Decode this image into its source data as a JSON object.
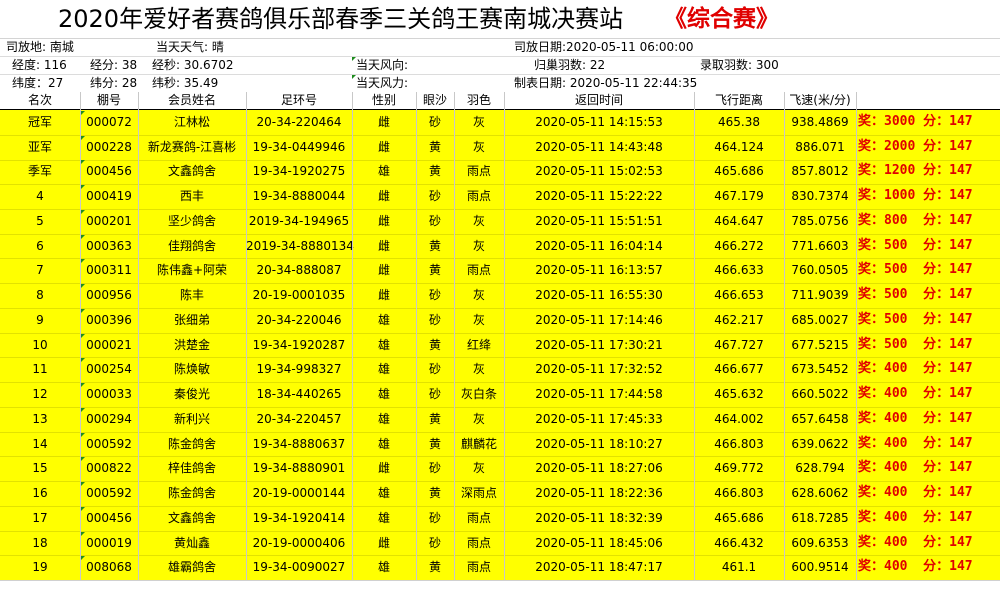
{
  "title": {
    "main": "2020年爱好者赛鸽俱乐部春季三关鸽王赛南城决赛站",
    "tag": "《综合赛》"
  },
  "info": {
    "release_place": "司放地: 南城",
    "weather": "当天天气: 晴",
    "release_date": "司放日期:2020-05-11 06:00:00",
    "longitude_deg": "经度: 116",
    "longitude_min": "经分: 38",
    "longitude_sec": "经秒: 30.6702",
    "wind_dir": "当天风向:",
    "returned": "归巢羽数: 22",
    "recorded": "录取羽数: 300",
    "latitude_deg": "纬度：27",
    "latitude_min": "纬分: 28",
    "latitude_sec": "纬秒: 35.49",
    "wind_force": "当天风力:",
    "made_date": "制表日期: 2020-05-11 22:44:35"
  },
  "columns": [
    "名次",
    "棚号",
    "会员姓名",
    "足环号",
    "性别",
    "眼沙",
    "羽色",
    "返回时间",
    "飞行距离",
    "飞速(米/分)"
  ],
  "rows": [
    {
      "rank": "冠军",
      "loft": "000072",
      "name": "江林松",
      "ring": "20-34-220464",
      "sex": "雌",
      "eye": "砂",
      "color": "灰",
      "time": "2020-05-11 14:15:53",
      "dist": "465.38",
      "speed": "938.4869",
      "prize": "奖：3000 分：147"
    },
    {
      "rank": "亚军",
      "loft": "000228",
      "name": "新龙赛鸽-江喜彬",
      "ring": "19-34-0449946",
      "sex": "雌",
      "eye": "黄",
      "color": "灰",
      "time": "2020-05-11 14:43:48",
      "dist": "464.124",
      "speed": "886.071",
      "prize": "奖：2000 分：147"
    },
    {
      "rank": "季军",
      "loft": "000456",
      "name": "文鑫鸽舍",
      "ring": "19-34-1920275",
      "sex": "雄",
      "eye": "黄",
      "color": "雨点",
      "time": "2020-05-11 15:02:53",
      "dist": "465.686",
      "speed": "857.8012",
      "prize": "奖：1200 分：147"
    },
    {
      "rank": "4",
      "loft": "000419",
      "name": "西丰",
      "ring": "19-34-8880044",
      "sex": "雌",
      "eye": "砂",
      "color": "雨点",
      "time": "2020-05-11 15:22:22",
      "dist": "467.179",
      "speed": "830.7374",
      "prize": "奖：1000 分：147"
    },
    {
      "rank": "5",
      "loft": "000201",
      "name": "坚少鸽舍",
      "ring": "2019-34-194965",
      "sex": "雌",
      "eye": "砂",
      "color": "灰",
      "time": "2020-05-11 15:51:51",
      "dist": "464.647",
      "speed": "785.0756",
      "prize": "奖：800  分：147"
    },
    {
      "rank": "6",
      "loft": "000363",
      "name": "佳翔鸽舍",
      "ring": "2019-34-8880134",
      "sex": "雌",
      "eye": "黄",
      "color": "灰",
      "time": "2020-05-11 16:04:14",
      "dist": "466.272",
      "speed": "771.6603",
      "prize": "奖：500  分：147"
    },
    {
      "rank": "7",
      "loft": "000311",
      "name": "陈伟鑫+阿荣",
      "ring": "20-34-888087",
      "sex": "雌",
      "eye": "黄",
      "color": "雨点",
      "time": "2020-05-11 16:13:57",
      "dist": "466.633",
      "speed": "760.0505",
      "prize": "奖：500  分：147"
    },
    {
      "rank": "8",
      "loft": "000956",
      "name": "陈丰",
      "ring": "20-19-0001035",
      "sex": "雌",
      "eye": "砂",
      "color": "灰",
      "time": "2020-05-11 16:55:30",
      "dist": "466.653",
      "speed": "711.9039",
      "prize": "奖：500  分：147"
    },
    {
      "rank": "9",
      "loft": "000396",
      "name": "张细弟",
      "ring": "20-34-220046",
      "sex": "雄",
      "eye": "砂",
      "color": "灰",
      "time": "2020-05-11 17:14:46",
      "dist": "462.217",
      "speed": "685.0027",
      "prize": "奖：500  分：147"
    },
    {
      "rank": "10",
      "loft": "000021",
      "name": "洪楚金",
      "ring": "19-34-1920287",
      "sex": "雄",
      "eye": "黄",
      "color": "红绛",
      "time": "2020-05-11 17:30:21",
      "dist": "467.727",
      "speed": "677.5215",
      "prize": "奖：500  分：147"
    },
    {
      "rank": "11",
      "loft": "000254",
      "name": "陈焕敏",
      "ring": "19-34-998327",
      "sex": "雄",
      "eye": "砂",
      "color": "灰",
      "time": "2020-05-11 17:32:52",
      "dist": "466.677",
      "speed": "673.5452",
      "prize": "奖：400  分：147"
    },
    {
      "rank": "12",
      "loft": "000033",
      "name": "秦俊光",
      "ring": "18-34-440265",
      "sex": "雄",
      "eye": "砂",
      "color": "灰白条",
      "time": "2020-05-11 17:44:58",
      "dist": "465.632",
      "speed": "660.5022",
      "prize": "奖：400  分：147"
    },
    {
      "rank": "13",
      "loft": "000294",
      "name": "新利兴",
      "ring": "20-34-220457",
      "sex": "雄",
      "eye": "黄",
      "color": "灰",
      "time": "2020-05-11 17:45:33",
      "dist": "464.002",
      "speed": "657.6458",
      "prize": "奖：400  分：147"
    },
    {
      "rank": "14",
      "loft": "000592",
      "name": "陈金鸽舍",
      "ring": "19-34-8880637",
      "sex": "雄",
      "eye": "黄",
      "color": "麒麟花",
      "time": "2020-05-11 18:10:27",
      "dist": "466.803",
      "speed": "639.0622",
      "prize": "奖：400  分：147"
    },
    {
      "rank": "15",
      "loft": "000822",
      "name": "梓佳鸽舍",
      "ring": "19-34-8880901",
      "sex": "雌",
      "eye": "砂",
      "color": "灰",
      "time": "2020-05-11 18:27:06",
      "dist": "469.772",
      "speed": "628.794",
      "prize": "奖：400  分：147"
    },
    {
      "rank": "16",
      "loft": "000592",
      "name": "陈金鸽舍",
      "ring": "20-19-0000144",
      "sex": "雄",
      "eye": "黄",
      "color": "深雨点",
      "time": "2020-05-11 18:22:36",
      "dist": "466.803",
      "speed": "628.6062",
      "prize": "奖：400  分：147"
    },
    {
      "rank": "17",
      "loft": "000456",
      "name": "文鑫鸽舍",
      "ring": "19-34-1920414",
      "sex": "雄",
      "eye": "砂",
      "color": "雨点",
      "time": "2020-05-11 18:32:39",
      "dist": "465.686",
      "speed": "618.7285",
      "prize": "奖：400  分：147"
    },
    {
      "rank": "18",
      "loft": "000019",
      "name": "黄灿鑫",
      "ring": "20-19-0000406",
      "sex": "雌",
      "eye": "砂",
      "color": "雨点",
      "time": "2020-05-11 18:45:06",
      "dist": "466.432",
      "speed": "609.6353",
      "prize": "奖：400  分：147"
    },
    {
      "rank": "19",
      "loft": "008068",
      "name": "雄霸鸽舍",
      "ring": "19-34-0090027",
      "sex": "雄",
      "eye": "黄",
      "color": "雨点",
      "time": "2020-05-11 18:47:17",
      "dist": "461.1",
      "speed": "600.9514",
      "prize": "奖：400  分：147"
    }
  ],
  "colors": {
    "highlight": "#ffff00",
    "prize_text": "#e00000",
    "title_tag": "#e00000",
    "comment_marker": "#1e8c1e"
  }
}
